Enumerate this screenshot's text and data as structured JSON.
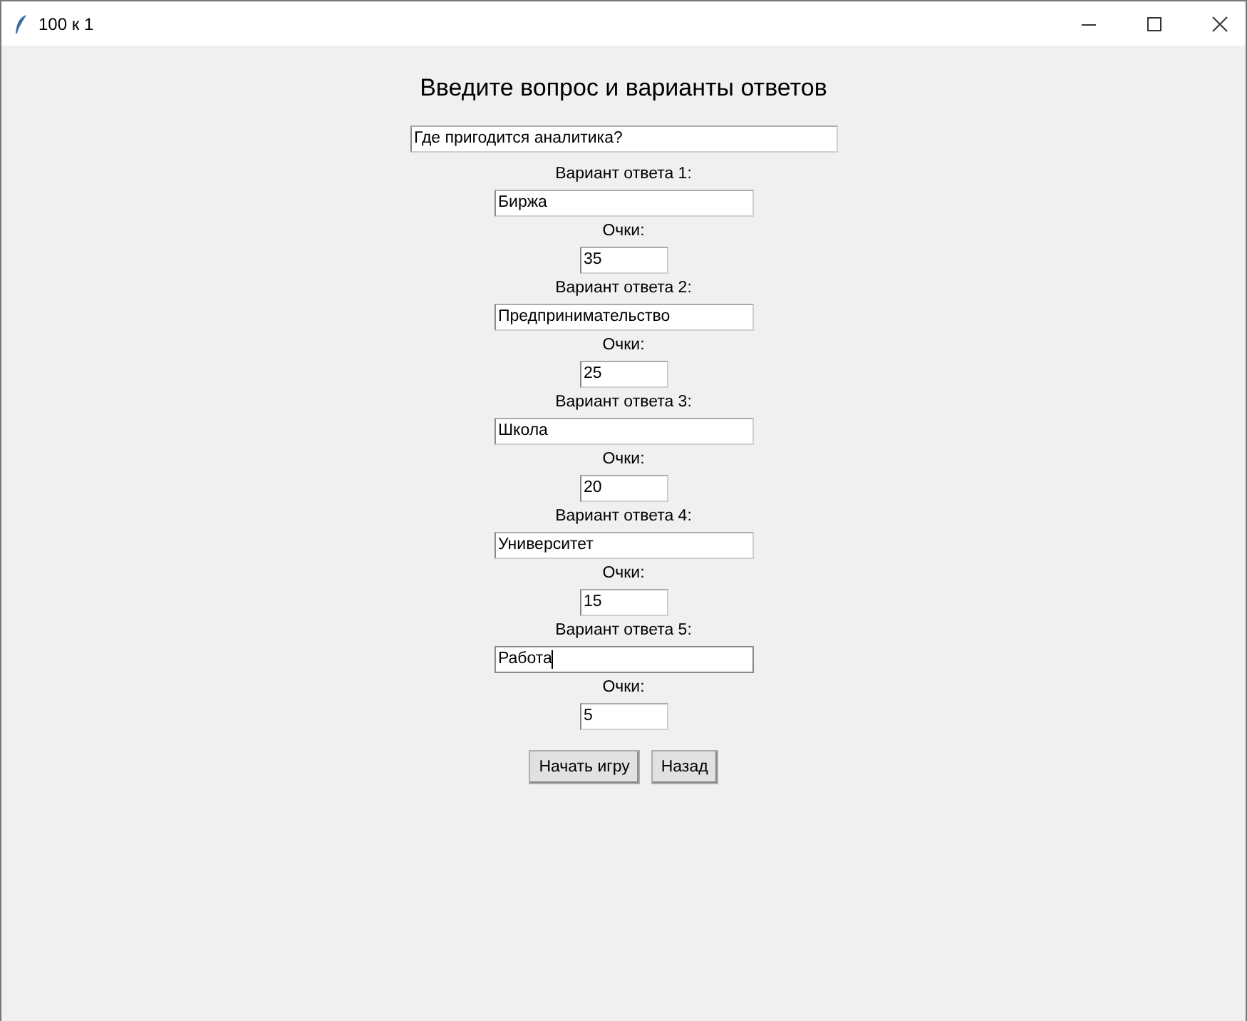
{
  "window": {
    "title": "100 к 1"
  },
  "heading": "Введите вопрос и варианты ответов",
  "question": {
    "value": "Где пригодится аналитика?",
    "focused": false
  },
  "answers": [
    {
      "label": "Вариант ответа 1:",
      "value": "Биржа",
      "focused": false,
      "points_label": "Очки:",
      "points": "35"
    },
    {
      "label": "Вариант ответа 2:",
      "value": "Предпринимательство",
      "focused": false,
      "points_label": "Очки:",
      "points": "25"
    },
    {
      "label": "Вариант ответа 3:",
      "value": "Школа",
      "focused": false,
      "points_label": "Очки:",
      "points": "20"
    },
    {
      "label": "Вариант ответа 4:",
      "value": "Университет",
      "focused": false,
      "points_label": "Очки:",
      "points": "15"
    },
    {
      "label": "Вариант ответа 5:",
      "value": "Работа",
      "focused": true,
      "points_label": "Очки:",
      "points": "5"
    }
  ],
  "buttons": [
    "Начать игру",
    "Назад"
  ]
}
